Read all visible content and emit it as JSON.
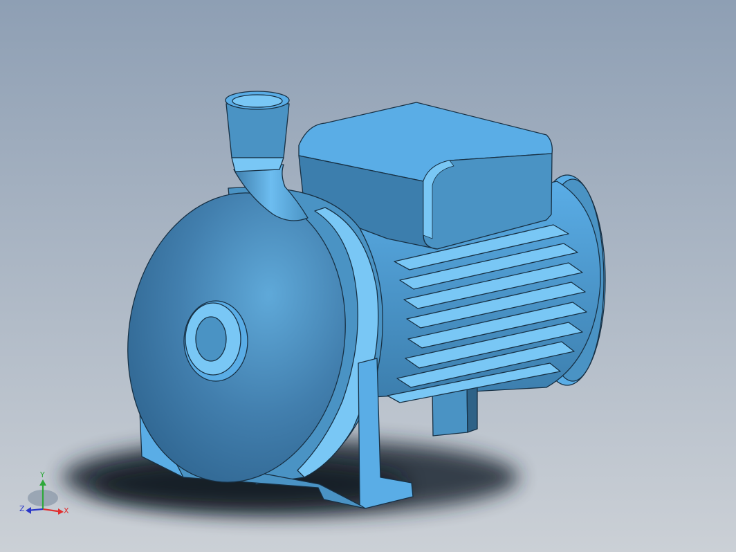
{
  "viewport": {
    "background_top": "#8E9FB4",
    "background_bottom": "#CBD0D6"
  },
  "model": {
    "name": "centrifugal-pump",
    "colors": {
      "base": "#5AADE6",
      "light": "#79C7F5",
      "mid": "#4A93C4",
      "dark": "#2E6287",
      "edge": "#173044",
      "shadow": "#1B2633"
    }
  },
  "triad": {
    "x_label": "X",
    "y_label": "Y",
    "z_label": "Z",
    "x_color": "#E03030",
    "y_color": "#2EA83A",
    "z_color": "#2A37C8"
  }
}
